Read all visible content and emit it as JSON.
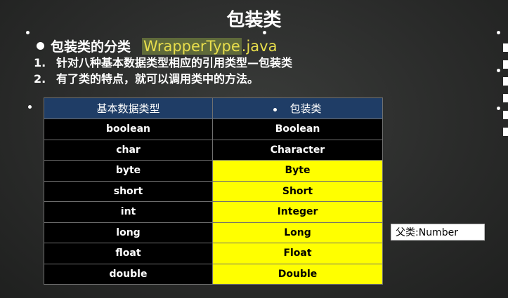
{
  "slide": {
    "title": "包装类",
    "heading": {
      "label": "包装类的分类",
      "filename_highlight": "WrapperType",
      "filename_ext": ".java"
    },
    "list": [
      {
        "num": "1.",
        "text": "针对八种基本数据类型相应的引用类型—包装类"
      },
      {
        "num": "2.",
        "text": "有了类的特点，就可以调用类中的方法。"
      }
    ],
    "table": {
      "headers": [
        "基本数据类型",
        "包装类"
      ],
      "rows": [
        {
          "primitive": "boolean",
          "wrapper": "Boolean",
          "highlight": false
        },
        {
          "primitive": "char",
          "wrapper": "Character",
          "highlight": false
        },
        {
          "primitive": "byte",
          "wrapper": "Byte",
          "highlight": true
        },
        {
          "primitive": "short",
          "wrapper": "Short",
          "highlight": true
        },
        {
          "primitive": "int",
          "wrapper": "Integer",
          "highlight": true
        },
        {
          "primitive": "long",
          "wrapper": "Long",
          "highlight": true
        },
        {
          "primitive": "float",
          "wrapper": "Float",
          "highlight": true
        },
        {
          "primitive": "double",
          "wrapper": "Double",
          "highlight": true
        }
      ]
    },
    "parent_note": "父类:Number",
    "colors": {
      "background": "#2b2c2b",
      "header_blue": "#1f3d66",
      "highlight_yellow": "#ffff00",
      "filename_yellow": "#e8de4c"
    }
  }
}
